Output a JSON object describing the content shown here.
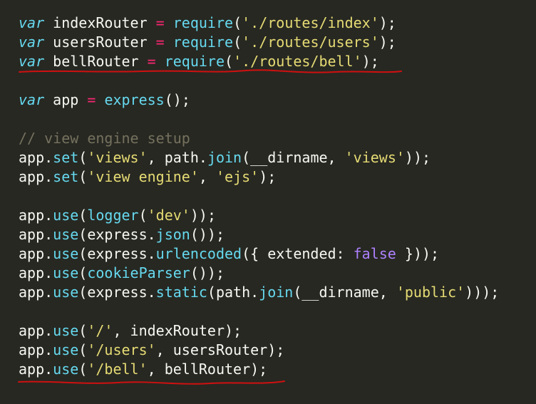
{
  "editor": {
    "lines": [
      [
        {
          "t": "var",
          "c": "kw"
        },
        {
          "t": " indexRouter ",
          "c": "pl"
        },
        {
          "t": "=",
          "c": "op"
        },
        {
          "t": " ",
          "c": "pl"
        },
        {
          "t": "require",
          "c": "fn"
        },
        {
          "t": "(",
          "c": "pl"
        },
        {
          "t": "'./routes/index'",
          "c": "str"
        },
        {
          "t": ");",
          "c": "pl"
        }
      ],
      [
        {
          "t": "var",
          "c": "kw"
        },
        {
          "t": " usersRouter ",
          "c": "pl"
        },
        {
          "t": "=",
          "c": "op"
        },
        {
          "t": " ",
          "c": "pl"
        },
        {
          "t": "require",
          "c": "fn"
        },
        {
          "t": "(",
          "c": "pl"
        },
        {
          "t": "'./routes/users'",
          "c": "str"
        },
        {
          "t": ");",
          "c": "pl"
        }
      ],
      [
        {
          "t": "var",
          "c": "kw"
        },
        {
          "t": " bellRouter ",
          "c": "pl"
        },
        {
          "t": "=",
          "c": "op"
        },
        {
          "t": " ",
          "c": "pl"
        },
        {
          "t": "require",
          "c": "fn"
        },
        {
          "t": "(",
          "c": "pl"
        },
        {
          "t": "'./routes/bell'",
          "c": "str"
        },
        {
          "t": ");",
          "c": "pl"
        }
      ],
      [],
      [
        {
          "t": "var",
          "c": "kw"
        },
        {
          "t": " app ",
          "c": "pl"
        },
        {
          "t": "=",
          "c": "op"
        },
        {
          "t": " ",
          "c": "pl"
        },
        {
          "t": "express",
          "c": "fn"
        },
        {
          "t": "();",
          "c": "pl"
        }
      ],
      [],
      [
        {
          "t": "// view engine setup",
          "c": "cm"
        }
      ],
      [
        {
          "t": "app.",
          "c": "pl"
        },
        {
          "t": "set",
          "c": "fn"
        },
        {
          "t": "(",
          "c": "pl"
        },
        {
          "t": "'views'",
          "c": "str"
        },
        {
          "t": ", path.",
          "c": "pl"
        },
        {
          "t": "join",
          "c": "fn"
        },
        {
          "t": "(__dirname, ",
          "c": "pl"
        },
        {
          "t": "'views'",
          "c": "str"
        },
        {
          "t": "));",
          "c": "pl"
        }
      ],
      [
        {
          "t": "app.",
          "c": "pl"
        },
        {
          "t": "set",
          "c": "fn"
        },
        {
          "t": "(",
          "c": "pl"
        },
        {
          "t": "'view engine'",
          "c": "str"
        },
        {
          "t": ", ",
          "c": "pl"
        },
        {
          "t": "'ejs'",
          "c": "str"
        },
        {
          "t": ");",
          "c": "pl"
        }
      ],
      [],
      [
        {
          "t": "app.",
          "c": "pl"
        },
        {
          "t": "use",
          "c": "fn"
        },
        {
          "t": "(",
          "c": "pl"
        },
        {
          "t": "logger",
          "c": "fn"
        },
        {
          "t": "(",
          "c": "pl"
        },
        {
          "t": "'dev'",
          "c": "str"
        },
        {
          "t": "));",
          "c": "pl"
        }
      ],
      [
        {
          "t": "app.",
          "c": "pl"
        },
        {
          "t": "use",
          "c": "fn"
        },
        {
          "t": "(express.",
          "c": "pl"
        },
        {
          "t": "json",
          "c": "fn"
        },
        {
          "t": "());",
          "c": "pl"
        }
      ],
      [
        {
          "t": "app.",
          "c": "pl"
        },
        {
          "t": "use",
          "c": "fn"
        },
        {
          "t": "(express.",
          "c": "pl"
        },
        {
          "t": "urlencoded",
          "c": "fn"
        },
        {
          "t": "({ extended: ",
          "c": "pl"
        },
        {
          "t": "false",
          "c": "bool"
        },
        {
          "t": " }));",
          "c": "pl"
        }
      ],
      [
        {
          "t": "app.",
          "c": "pl"
        },
        {
          "t": "use",
          "c": "fn"
        },
        {
          "t": "(",
          "c": "pl"
        },
        {
          "t": "cookieParser",
          "c": "fn"
        },
        {
          "t": "());",
          "c": "pl"
        }
      ],
      [
        {
          "t": "app.",
          "c": "pl"
        },
        {
          "t": "use",
          "c": "fn"
        },
        {
          "t": "(express.",
          "c": "pl"
        },
        {
          "t": "static",
          "c": "fn"
        },
        {
          "t": "(path.",
          "c": "pl"
        },
        {
          "t": "join",
          "c": "fn"
        },
        {
          "t": "(__dirname, ",
          "c": "pl"
        },
        {
          "t": "'public'",
          "c": "str"
        },
        {
          "t": ")));",
          "c": "pl"
        }
      ],
      [],
      [
        {
          "t": "app.",
          "c": "pl"
        },
        {
          "t": "use",
          "c": "fn"
        },
        {
          "t": "(",
          "c": "pl"
        },
        {
          "t": "'/'",
          "c": "str"
        },
        {
          "t": ", indexRouter);",
          "c": "pl"
        }
      ],
      [
        {
          "t": "app.",
          "c": "pl"
        },
        {
          "t": "use",
          "c": "fn"
        },
        {
          "t": "(",
          "c": "pl"
        },
        {
          "t": "'/users'",
          "c": "str"
        },
        {
          "t": ", usersRouter);",
          "c": "pl"
        }
      ],
      [
        {
          "t": "app.",
          "c": "pl"
        },
        {
          "t": "use",
          "c": "fn"
        },
        {
          "t": "(",
          "c": "pl"
        },
        {
          "t": "'/bell'",
          "c": "str"
        },
        {
          "t": ", bellRouter);",
          "c": "pl"
        }
      ]
    ]
  },
  "colors": {
    "background": "#272822",
    "plain": "#f8f8f2",
    "keyword": "#66d9ef",
    "function": "#66d9ef",
    "string": "#e6db74",
    "operator": "#f92672",
    "comment": "#75715e",
    "boolean": "#ae81ff",
    "annotation_underline": "#d01010"
  },
  "annotations": {
    "underlined_lines": [
      3,
      19
    ]
  }
}
